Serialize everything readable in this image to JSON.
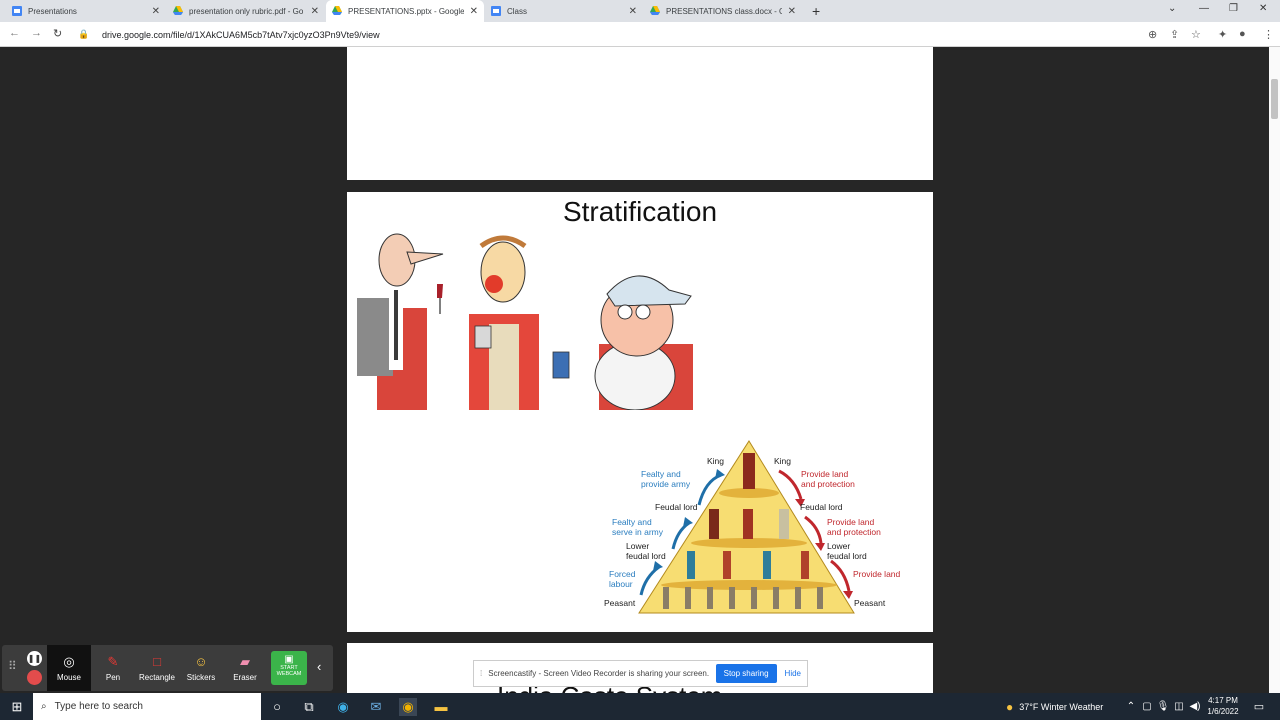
{
  "tabs": [
    {
      "title": "Presentations",
      "icon": "slides-icon"
    },
    {
      "title": "presentation only rubric.pdf - Go",
      "icon": "drive-icon"
    },
    {
      "title": "PRESENTATIONS.pptx - Google D",
      "icon": "drive-icon",
      "active": true
    },
    {
      "title": "Class",
      "icon": "slides-icon"
    },
    {
      "title": "PRESENTATIONS class.docx - Go",
      "icon": "drive-icon"
    }
  ],
  "address": {
    "url": "drive.google.com/file/d/1XAkCUA6M5cb7tAtv7xjc0yzO3Pn9Vte9/view"
  },
  "slide": {
    "title": "Stratification",
    "pyramid": {
      "king_left": "King",
      "king_right": "King",
      "fealty_army_1": "Fealty and",
      "fealty_army_2": "provide army",
      "provide_land_protection_1": "Provide land",
      "provide_land_protection_2": "and protection",
      "feudal_lord_left": "Feudal lord",
      "feudal_lord_right": "Feudal lord",
      "fealty_serve_1": "Fealty and",
      "fealty_serve_2": "serve in army",
      "provide_land_protection2_1": "Provide land",
      "provide_land_protection2_2": "and protection",
      "lower_left_1": "Lower",
      "lower_left_2": "feudal lord",
      "lower_right_1": "Lower",
      "lower_right_2": "feudal lord",
      "forced_1": "Forced",
      "forced_2": "labour",
      "provide_land": "Provide land",
      "peasant_left": "Peasant",
      "peasant_right": "Peasant"
    },
    "next_title_partial": "India Caste System"
  },
  "toolbar": {
    "tools": [
      {
        "label": "Mouse",
        "icon": "cursor-icon"
      },
      {
        "label": "Pen",
        "icon": "pen-icon"
      },
      {
        "label": "Rectangle",
        "icon": "rectangle-icon"
      },
      {
        "label": "Stickers",
        "icon": "sticker-icon"
      },
      {
        "label": "Eraser",
        "icon": "eraser-icon"
      }
    ],
    "webcam_line1": "START",
    "webcam_line2": "WEBCAM"
  },
  "share": {
    "message": "Screencastify - Screen Video Recorder is sharing your screen.",
    "stop": "Stop sharing",
    "hide": "Hide"
  },
  "taskbar": {
    "search_placeholder": "Type here to search",
    "weather": "37°F  Winter Weather",
    "time": "4:17 PM",
    "date": "1/6/2022"
  },
  "colors": {
    "blue_arrow": "#1f6fa8",
    "red_arrow": "#c0272d",
    "pyramid_fill": "#f7dd72",
    "stop_button": "#1a73e8",
    "webcam": "#3bb44a"
  }
}
